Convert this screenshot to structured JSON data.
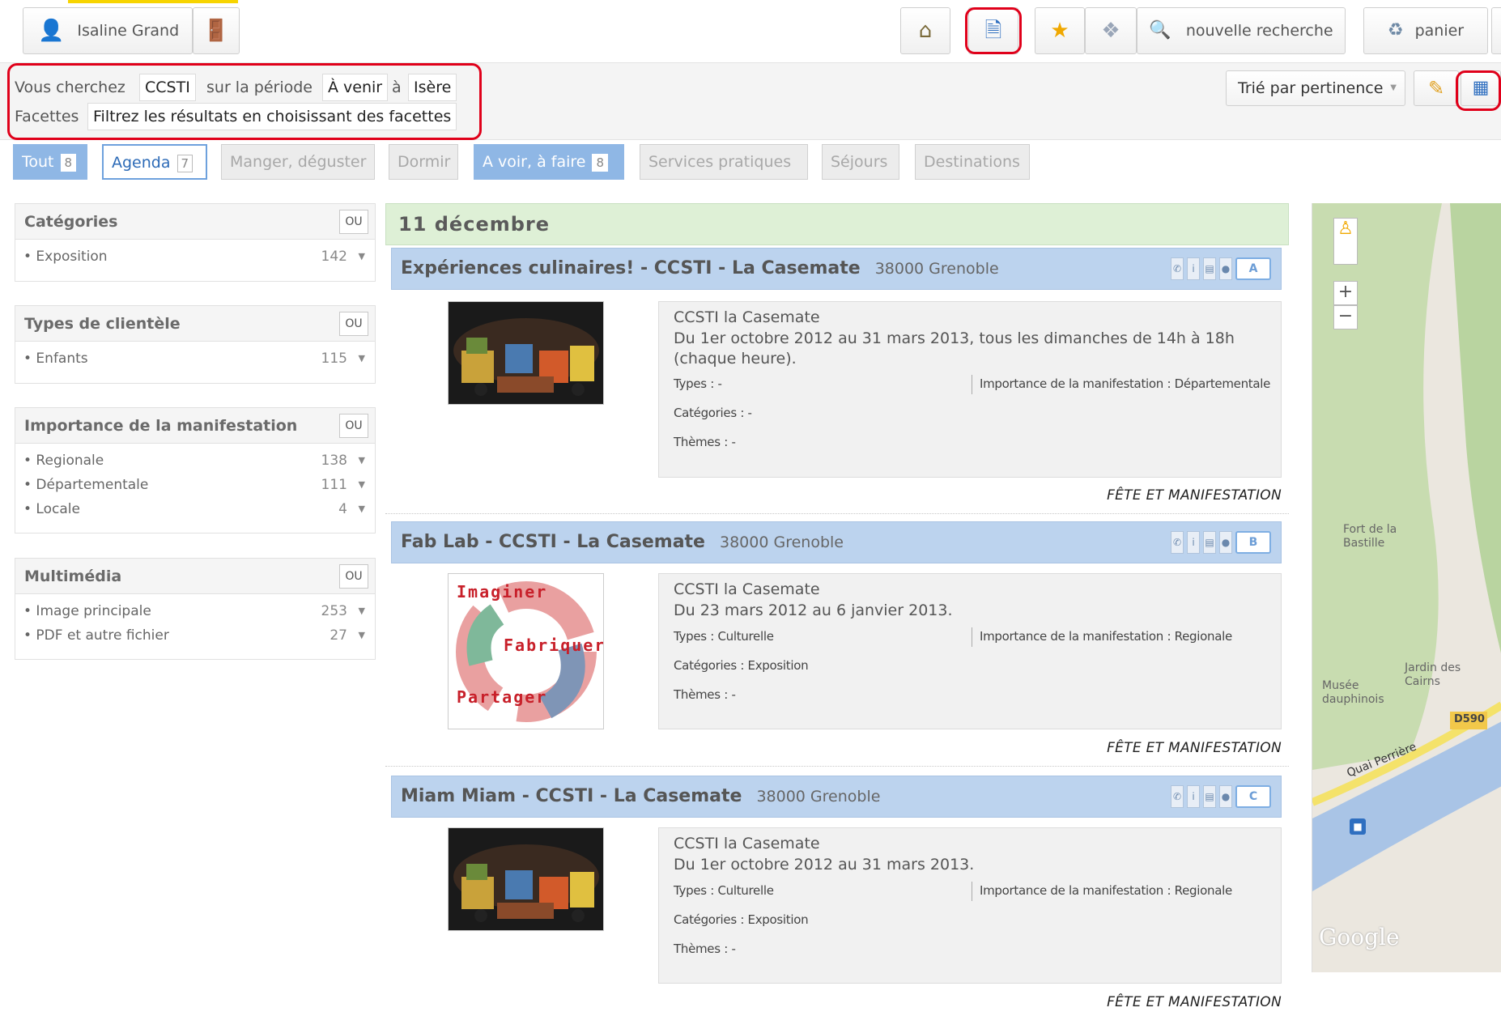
{
  "topbar": {
    "user_name": "Isaline Grand",
    "new_search_label": "nouvelle recherche",
    "basket_label": "panier",
    "icons": [
      "user-icon",
      "logout-door-icon",
      "home-icon",
      "export-icon",
      "star-icon",
      "tag-icon",
      "magnifier-icon",
      "basket-icon"
    ]
  },
  "search": {
    "prefix": "Vous cherchez",
    "query": "CCSTI",
    "period_label": "sur la période",
    "period": "À venir",
    "place_label": "à",
    "place": "Isère",
    "facets_label": "Facettes",
    "facets_hint": "Filtrez les résultats en choisissant des facettes",
    "sort_label": "Trié par pertinence"
  },
  "tabs": [
    {
      "label": "Tout",
      "count": "8"
    },
    {
      "label": "Agenda",
      "count": "7"
    },
    {
      "label": "Manger, déguster",
      "count": ""
    },
    {
      "label": "Dormir",
      "count": ""
    },
    {
      "label": "A voir, à faire",
      "count": "8"
    },
    {
      "label": "Services pratiques",
      "count": ""
    },
    {
      "label": "Séjours",
      "count": ""
    },
    {
      "label": "Destinations",
      "count": ""
    }
  ],
  "facets": [
    {
      "title": "Catégories",
      "op": "OU",
      "items": [
        {
          "label": "• Exposition",
          "count": "142"
        }
      ]
    },
    {
      "title": "Types de clientèle",
      "op": "OU",
      "items": [
        {
          "label": "• Enfants",
          "count": "115"
        }
      ]
    },
    {
      "title": "Importance de la manifestation",
      "op": "OU",
      "items": [
        {
          "label": "• Regionale",
          "count": "138"
        },
        {
          "label": "• Départementale",
          "count": "111"
        },
        {
          "label": "• Locale",
          "count": "4"
        }
      ]
    },
    {
      "title": "Multimédia",
      "op": "OU",
      "items": [
        {
          "label": "• Image principale",
          "count": "253"
        },
        {
          "label": "• PDF et autre fichier",
          "count": "27"
        }
      ]
    }
  ],
  "results_date": "11 décembre",
  "results": [
    {
      "title": "Expériences culinaires! - CCSTI - La Casemate",
      "city": "38000 Grenoble",
      "letter": "A",
      "org": "CCSTI la Casemate",
      "dates": "Du 1er octobre 2012 au 31 mars 2013, tous les dimanches de 14h à 18h (chaque heure).",
      "types": "Types : -",
      "importance": "Importance de la manifestation : Départementale",
      "categories": "Catégories : -",
      "themes": "Thèmes : -",
      "kind": "FÊTE ET MANIFESTATION",
      "thumb": "robots"
    },
    {
      "title": "Fab Lab - CCSTI - La Casemate",
      "city": "38000 Grenoble",
      "letter": "B",
      "org": "CCSTI la Casemate",
      "dates": "Du 23 mars 2012 au 6 janvier 2013.",
      "types": "Types : Culturelle",
      "importance": "Importance de la manifestation : Regionale",
      "categories": "Catégories : Exposition",
      "themes": "Thèmes : -",
      "kind": "FÊTE ET MANIFESTATION",
      "thumb": "fablab",
      "thumb_words": [
        "Imaginer",
        "Fabriquer",
        "Partager"
      ]
    },
    {
      "title": "Miam Miam - CCSTI - La Casemate",
      "city": "38000 Grenoble",
      "letter": "C",
      "org": "CCSTI la Casemate",
      "dates": "Du 1er octobre 2012 au 31 mars 2013.",
      "types": "Types : Culturelle",
      "importance": "Importance de la manifestation : Regionale",
      "categories": "Catégories : Exposition",
      "themes": "Thèmes : -",
      "kind": "FÊTE ET MANIFESTATION",
      "thumb": "robots"
    }
  ],
  "map": {
    "labels": [
      "Fort de la Bastille",
      "Jardin des Cairns",
      "Musée dauphinois",
      "D590",
      "Quai Perrière",
      "Google"
    ],
    "zoom_in": "+",
    "zoom_out": "−"
  },
  "colors": {
    "accent_blue": "#8fb7e5",
    "highlight_red": "#e0001a",
    "date_green": "#def0d6"
  }
}
